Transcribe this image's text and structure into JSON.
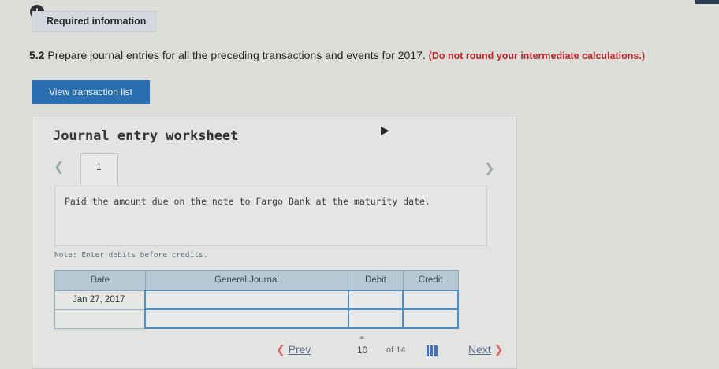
{
  "header": {
    "alert_glyph": "!",
    "required_label": "Required information"
  },
  "question": {
    "number": "5.2",
    "text": " Prepare journal entries for all the preceding transactions and events for 2017. ",
    "note": "(Do not round your intermediate calculations.)"
  },
  "view_button": "View transaction list",
  "worksheet": {
    "title": "Journal entry worksheet",
    "tab_number": "1",
    "description": "Paid the amount due on the note to Fargo Bank at the maturity date.",
    "note": "Note: Enter debits before credits."
  },
  "table": {
    "headers": {
      "date": "Date",
      "journal": "General Journal",
      "debit": "Debit",
      "credit": "Credit"
    },
    "rows": [
      {
        "date": "Jan 27, 2017"
      },
      {
        "date": ""
      }
    ]
  },
  "pagination": {
    "prev": "Prev",
    "current": "10",
    "of": "of 14",
    "next": "Next"
  },
  "icons": {
    "alert": "alert-icon",
    "link": "link-icon",
    "grid": "grid-icon",
    "cursor": "cursor-icon"
  }
}
